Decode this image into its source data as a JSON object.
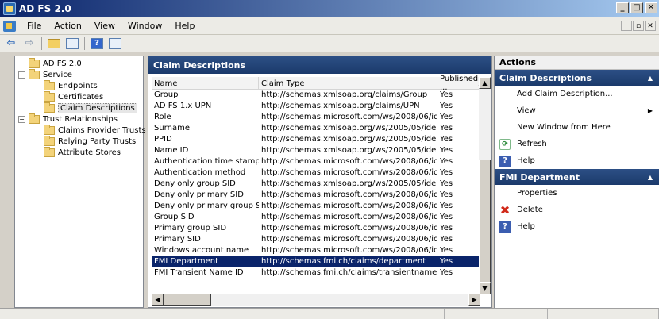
{
  "window": {
    "title": "AD FS 2.0"
  },
  "menu": [
    "File",
    "Action",
    "View",
    "Window",
    "Help"
  ],
  "tree": [
    {
      "label": "AD FS 2.0",
      "level": 0,
      "expander": "",
      "selected": false
    },
    {
      "label": "Service",
      "level": 0,
      "expander": "−",
      "selected": false
    },
    {
      "label": "Endpoints",
      "level": 1,
      "expander": "",
      "selected": false
    },
    {
      "label": "Certificates",
      "level": 1,
      "expander": "",
      "selected": false
    },
    {
      "label": "Claim Descriptions",
      "level": 1,
      "expander": "",
      "selected": true
    },
    {
      "label": "Trust Relationships",
      "level": 0,
      "expander": "−",
      "selected": false
    },
    {
      "label": "Claims Provider Trusts",
      "level": 1,
      "expander": "",
      "selected": false
    },
    {
      "label": "Relying Party Trusts",
      "level": 1,
      "expander": "",
      "selected": false
    },
    {
      "label": "Attribute Stores",
      "level": 1,
      "expander": "",
      "selected": false
    }
  ],
  "center": {
    "title": "Claim Descriptions",
    "columns": [
      "Name",
      "Claim Type",
      "Published ..."
    ],
    "rows": [
      [
        "Group",
        "http://schemas.xmlsoap.org/claims/Group",
        "Yes"
      ],
      [
        "AD FS 1.x UPN",
        "http://schemas.xmlsoap.org/claims/UPN",
        "Yes"
      ],
      [
        "Role",
        "http://schemas.microsoft.com/ws/2008/06/iden...",
        "Yes"
      ],
      [
        "Surname",
        "http://schemas.xmlsoap.org/ws/2005/05/identit...",
        "Yes"
      ],
      [
        "PPID",
        "http://schemas.xmlsoap.org/ws/2005/05/identit...",
        "Yes"
      ],
      [
        "Name ID",
        "http://schemas.xmlsoap.org/ws/2005/05/identit...",
        "Yes"
      ],
      [
        "Authentication time stamp",
        "http://schemas.microsoft.com/ws/2008/06/iden...",
        "Yes"
      ],
      [
        "Authentication method",
        "http://schemas.microsoft.com/ws/2008/06/iden...",
        "Yes"
      ],
      [
        "Deny only group SID",
        "http://schemas.xmlsoap.org/ws/2005/05/identit...",
        "Yes"
      ],
      [
        "Deny only primary SID",
        "http://schemas.microsoft.com/ws/2008/06/iden...",
        "Yes"
      ],
      [
        "Deny only primary group SID",
        "http://schemas.microsoft.com/ws/2008/06/iden...",
        "Yes"
      ],
      [
        "Group SID",
        "http://schemas.microsoft.com/ws/2008/06/iden...",
        "Yes"
      ],
      [
        "Primary group SID",
        "http://schemas.microsoft.com/ws/2008/06/iden...",
        "Yes"
      ],
      [
        "Primary SID",
        "http://schemas.microsoft.com/ws/2008/06/iden...",
        "Yes"
      ],
      [
        "Windows account name",
        "http://schemas.microsoft.com/ws/2008/06/iden...",
        "Yes"
      ],
      [
        "FMI Department",
        "http://schemas.fmi.ch/claims/department",
        "Yes"
      ],
      [
        "FMI Transient Name ID",
        "http://schemas.fmi.ch/claims/transientnameident...",
        "Yes"
      ]
    ],
    "selected_row": 15
  },
  "actions": {
    "title": "Actions",
    "sections": [
      {
        "title": "Claim Descriptions",
        "items": [
          {
            "label": "Add Claim Description...",
            "icon": "blank",
            "submenu": false
          },
          {
            "label": "View",
            "icon": "blank",
            "submenu": true
          },
          {
            "label": "New Window from Here",
            "icon": "blank",
            "submenu": false
          },
          {
            "label": "Refresh",
            "icon": "refresh",
            "submenu": false
          },
          {
            "label": "Help",
            "icon": "help",
            "submenu": false
          }
        ]
      },
      {
        "title": "FMI Department",
        "items": [
          {
            "label": "Properties",
            "icon": "blank",
            "submenu": false
          },
          {
            "label": "Delete",
            "icon": "delete",
            "submenu": false
          },
          {
            "label": "Help",
            "icon": "help",
            "submenu": false
          }
        ]
      }
    ]
  }
}
